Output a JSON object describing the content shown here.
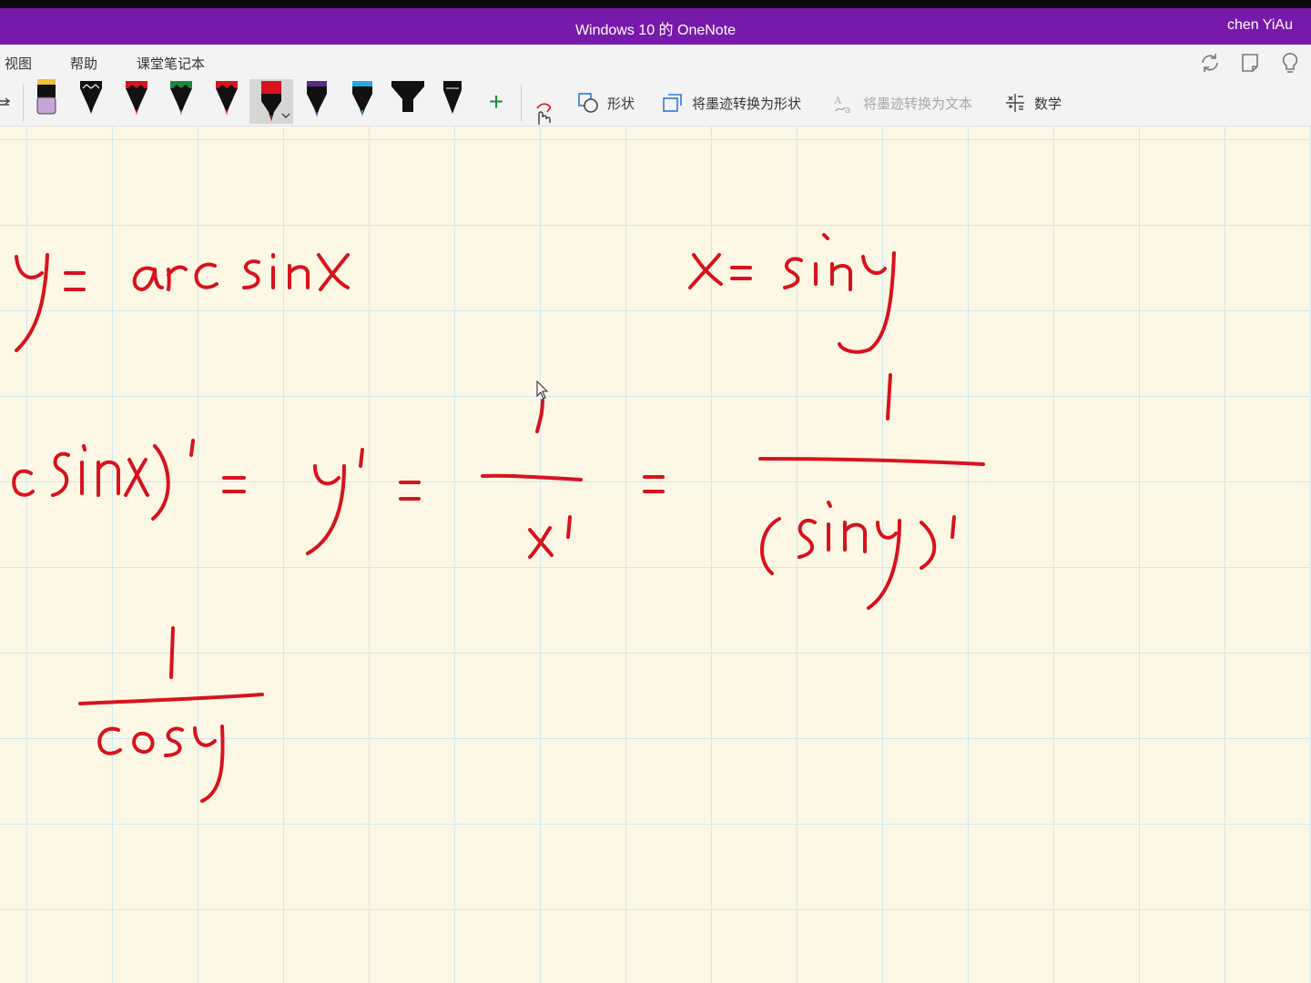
{
  "window": {
    "title": "Windows 10 的 OneNote",
    "user": "chen YiAu",
    "accent": "#7719aa"
  },
  "ribbon": {
    "tabs": [
      "视图",
      "帮助",
      "课堂笔记本"
    ],
    "right_icons": [
      "sync-icon",
      "notebook-icon",
      "lightbulb-icon"
    ],
    "pens": [
      {
        "name": "highlighter-pencil",
        "color": "#c8a3d8"
      },
      {
        "name": "pen",
        "color": "#111111"
      },
      {
        "name": "pen",
        "color": "#d8121f"
      },
      {
        "name": "pen",
        "color": "#1a8a3a"
      },
      {
        "name": "pen",
        "color": "#d8121f"
      },
      {
        "name": "pen-selected",
        "color": "#d8121f"
      },
      {
        "name": "pen",
        "color": "#5a2a8a"
      },
      {
        "name": "pen",
        "color": "#29a8e0"
      },
      {
        "name": "highlighter",
        "color": "#111111"
      },
      {
        "name": "pen",
        "color": "#111111"
      }
    ],
    "add_pen": "+",
    "commands": {
      "shapes": "形状",
      "ink_to_shape": "将墨迹转换为形状",
      "ink_to_text": "将墨迹转换为文本",
      "math": "数学"
    }
  },
  "canvas": {
    "ink_color": "#d8121f",
    "paper_color": "#fdf8e5",
    "grid_color": "#cfe8f2"
  }
}
